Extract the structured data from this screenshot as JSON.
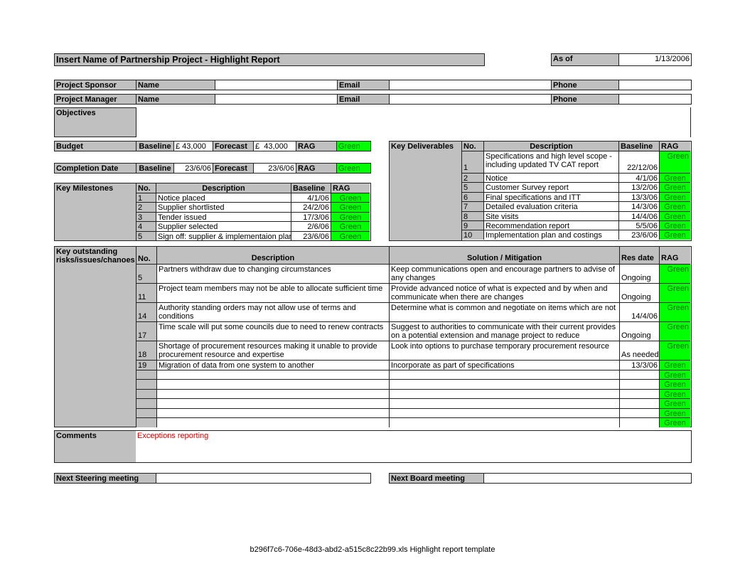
{
  "header": {
    "title": "Insert Name of Partnership Project - Highlight Report",
    "as_of_label": "As of",
    "as_of_value": "1/13/2006"
  },
  "people": [
    {
      "role": "Project Sponsor",
      "name_label": "Name",
      "name_value": "",
      "email_label": "Email",
      "email_value": "",
      "phone_label": "Phone",
      "phone_value": ""
    },
    {
      "role": "Project Manager",
      "name_label": "Name",
      "name_value": "",
      "email_label": "Email",
      "email_value": "",
      "phone_label": "Phone",
      "phone_value": ""
    }
  ],
  "objectives": {
    "label": "Objectives",
    "value": ""
  },
  "budget": {
    "label": "Budget",
    "baseline_label": "Baseline",
    "baseline": "£ 43,000",
    "forecast_label": "Forecast",
    "forecast": "£  43,000",
    "rag_label": "RAG",
    "rag": "Green"
  },
  "completion": {
    "label": "Completion Date",
    "baseline_label": "Baseline",
    "baseline": "23/6/06",
    "forecast_label": "Forecast",
    "forecast": "23/6/06",
    "rag_label": "RAG",
    "rag": "Green"
  },
  "milestones": {
    "label": "Key Milestones",
    "columns": [
      "No.",
      "Description",
      "Baseline",
      "RAG"
    ],
    "rows": [
      {
        "no": "1",
        "desc": "Notice placed",
        "baseline": "4/1/06",
        "rag": "Green"
      },
      {
        "no": "2",
        "desc": "Supplier shortlisted",
        "baseline": "24/2/06",
        "rag": "Green"
      },
      {
        "no": "3",
        "desc": "Tender issued",
        "baseline": "17/3/06",
        "rag": "Green"
      },
      {
        "no": "4",
        "desc": "Supplier selected",
        "baseline": "2/6/06",
        "rag": "Green"
      },
      {
        "no": "5",
        "desc": "Sign off: supplier & implementaion plan",
        "baseline": "23/6/06",
        "rag": "Green"
      }
    ]
  },
  "deliverables": {
    "label": "Key Deliverables",
    "columns": [
      "No.",
      "Description",
      "Baseline",
      "RAG"
    ],
    "rows": [
      {
        "no": "1",
        "desc": "Specifications and high level scope - including updated TV CAT report",
        "baseline": "22/12/06",
        "rag": "Green"
      },
      {
        "no": "2",
        "desc": "Notice",
        "baseline": "4/1/06",
        "rag": "Green"
      },
      {
        "no": "5",
        "desc": "Customer Survey report",
        "baseline": "13/2/06",
        "rag": "Green"
      },
      {
        "no": "6",
        "desc": "Final specifications and ITT",
        "baseline": "13/3/06",
        "rag": "Green"
      },
      {
        "no": "7",
        "desc": "Detailed evaluation criteria",
        "baseline": "14/3/06",
        "rag": "Green"
      },
      {
        "no": "8",
        "desc": "Site visits",
        "baseline": "14/4/06",
        "rag": "Green"
      },
      {
        "no": "9",
        "desc": "Recommendation report",
        "baseline": "5/5/06",
        "rag": "Green"
      },
      {
        "no": "10",
        "desc": "Implementation plan and costings",
        "baseline": "23/6/06",
        "rag": "Green"
      }
    ]
  },
  "risks": {
    "label": "Key outstanding risks/issues/chanoes",
    "columns": [
      "No.",
      "Description",
      "Solution / Mitigation",
      "Res date",
      "RAG"
    ],
    "rows": [
      {
        "no": "5",
        "desc": "Partners withdraw due to changing circumstances",
        "solution": "Keep communications open and encourage partners to advise of any changes",
        "res_date": "Ongoing",
        "rag": "Green"
      },
      {
        "no": "11",
        "desc": "Project team members may not be able to allocate sufficient time",
        "solution": "Provide advanced notice of what is expected and by when and communicate when there are changes",
        "res_date": "Ongoing",
        "rag": "Green"
      },
      {
        "no": "14",
        "desc": "Authority standing orders may not allow use of terms and conditions",
        "solution": "Determine what is common and negotiate on items which are not",
        "res_date": "14/4/06",
        "rag": "Green"
      },
      {
        "no": "17",
        "desc": "Time scale will put some councils due to need to renew contracts",
        "solution": "Suggest to authorities to communicate with their current provides on a potential extension and manage project to reduce slipperage",
        "res_date": "Ongoing",
        "rag": "Green"
      },
      {
        "no": "18",
        "desc": "Shortage of procurement resources making it unable to provide procurement resource and expertise",
        "solution": "Look into options to purchase temporary procurement resource",
        "res_date": "As needed",
        "rag": "Green"
      },
      {
        "no": "19",
        "desc": "Migration of data from one system to another",
        "solution": "Incorporate as part of specifications",
        "res_date": "13/3/06",
        "rag": "Green"
      },
      {
        "no": "",
        "desc": "",
        "solution": "",
        "res_date": "",
        "rag": "Green"
      },
      {
        "no": "",
        "desc": "",
        "solution": "",
        "res_date": "",
        "rag": "Green"
      },
      {
        "no": "",
        "desc": "",
        "solution": "",
        "res_date": "",
        "rag": "Green"
      },
      {
        "no": "",
        "desc": "",
        "solution": "",
        "res_date": "",
        "rag": "Green"
      },
      {
        "no": "",
        "desc": "",
        "solution": "",
        "res_date": "",
        "rag": "Green"
      },
      {
        "no": "",
        "desc": "",
        "solution": "",
        "res_date": "",
        "rag": "Green"
      }
    ]
  },
  "comments": {
    "label": "Comments",
    "value": "Exceptions reporting"
  },
  "meetings": {
    "steering_label": "Next Steering  meeting",
    "steering_value": "",
    "board_label": "Next Board meeting",
    "board_value": ""
  },
  "footer": {
    "text": "b296f7c6-706e-48d3-abd2-a515c8c22b99.xls  Highlight report template"
  },
  "colors": {
    "header_gray": "#c0c0c0",
    "rag_green": "#00ff00",
    "comment_red": "#e00000"
  }
}
